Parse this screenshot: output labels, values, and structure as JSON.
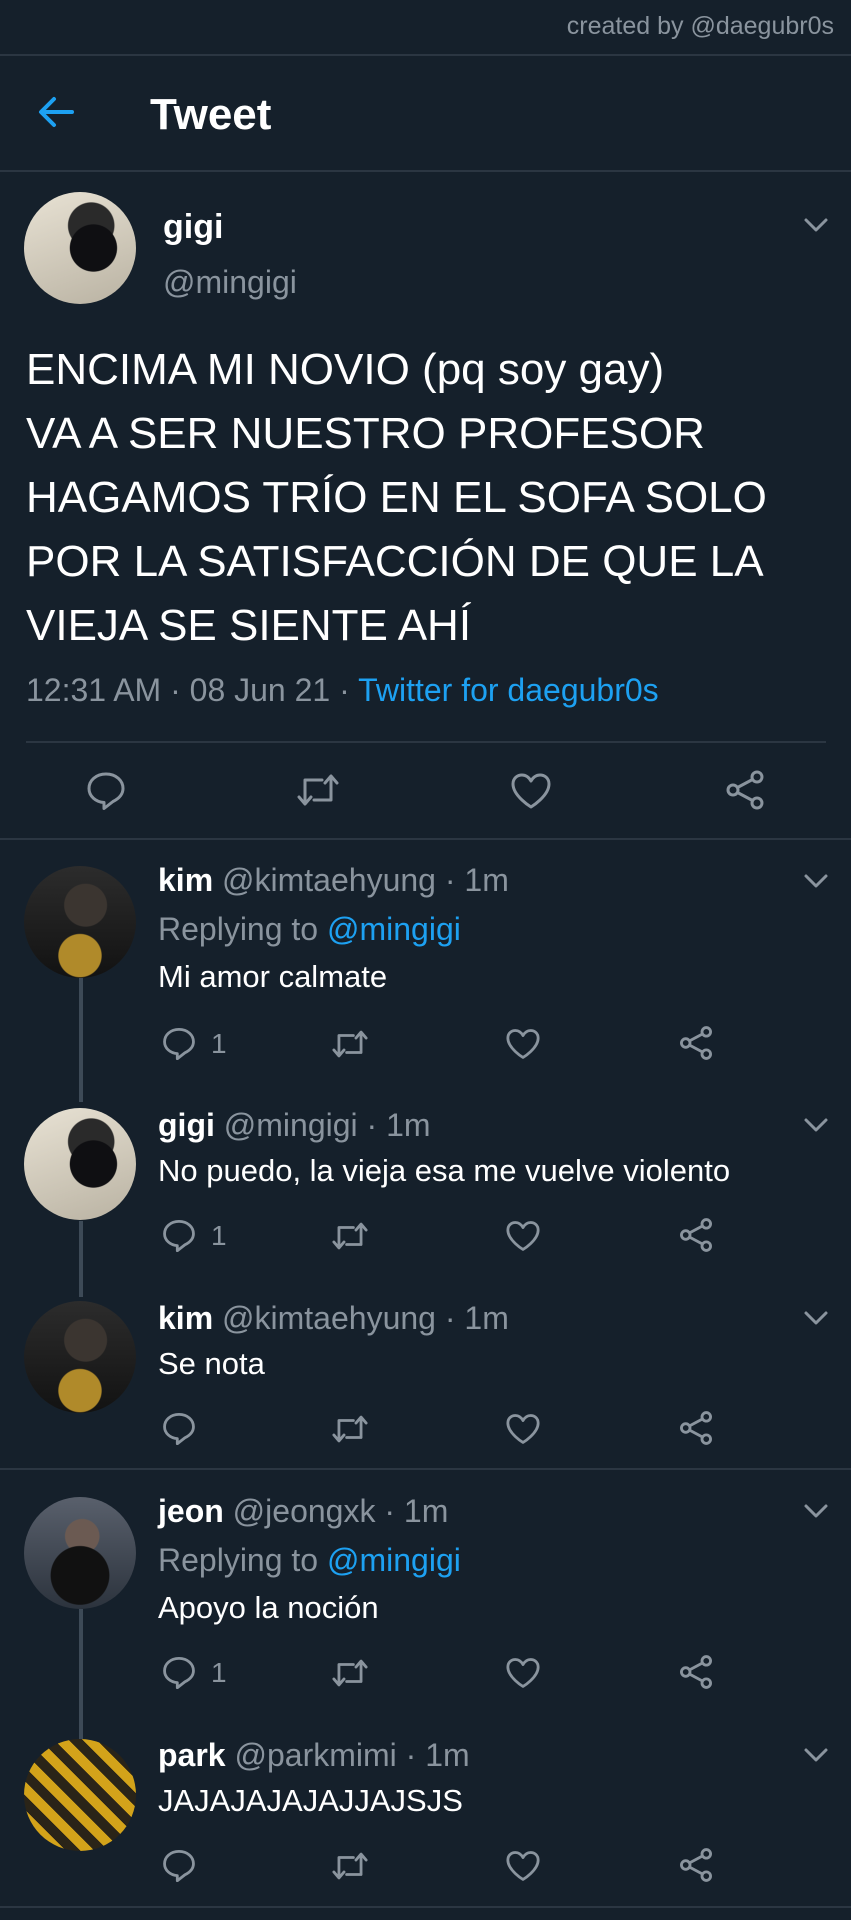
{
  "credit": "created by @daegubr0s",
  "header": {
    "title": "Tweet"
  },
  "main_tweet": {
    "name": "gigi",
    "handle": "@mingigi",
    "text_lines": [
      "ENCIMA MI NOVIO (pq soy gay)",
      "VA A SER NUESTRO PROFESOR",
      "HAGAMOS TRÍO EN EL SOFA SOLO",
      "POR LA SATISFACCIÓN DE QUE LA",
      "VIEJA SE SIENTE AHÍ"
    ],
    "time_date": "12:31 AM · 08 Jun 21 · ",
    "source": "Twitter for daegubr0s"
  },
  "replies": [
    {
      "name": "kim",
      "meta": " @kimtaehyung · 1m",
      "replying_label": "Replying to ",
      "replying_to": "@mingigi",
      "text": "Mi amor calmate",
      "reply_count": "1"
    },
    {
      "name": "gigi",
      "meta": " @mingigi · 1m",
      "text": "No puedo, la vieja esa me vuelve violento",
      "reply_count": "1"
    },
    {
      "name": "kim",
      "meta": " @kimtaehyung · 1m",
      "text": "Se nota",
      "reply_count": ""
    },
    {
      "name": "jeon",
      "meta": " @jeongxk · 1m",
      "replying_label": "Replying to ",
      "replying_to": "@mingigi",
      "text": "Apoyo la noción",
      "reply_count": "1"
    },
    {
      "name": "park",
      "meta": " @parkmimi · 1m",
      "text": "JAJAJAJAJAJJAJSJS",
      "reply_count": ""
    }
  ],
  "colors": {
    "background": "#15202b",
    "accent": "#1da1f2",
    "muted": "#8a949e",
    "divider": "#2b3642"
  }
}
